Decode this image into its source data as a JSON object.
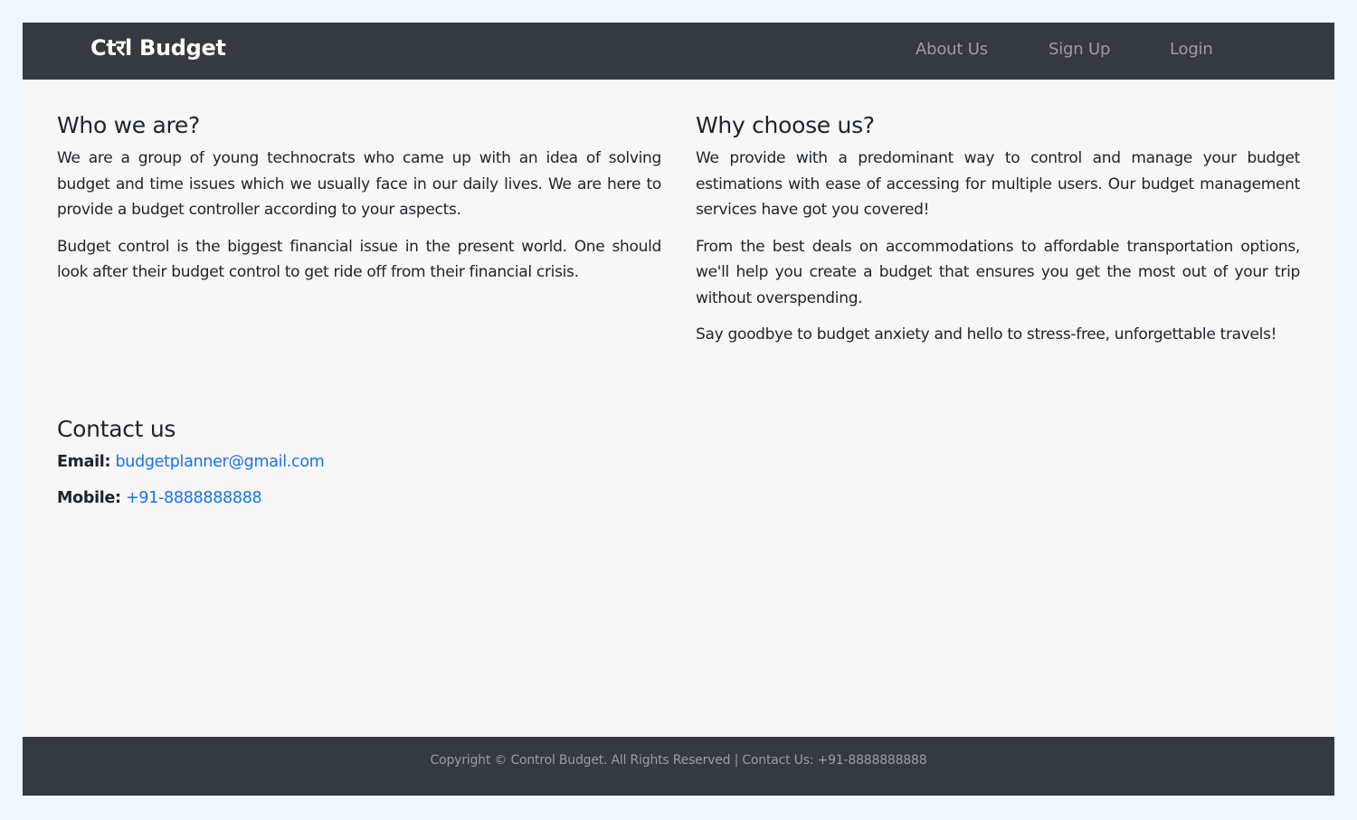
{
  "navbar": {
    "brand": "Ctरl Budget",
    "links": [
      "About Us",
      "Sign Up",
      "Login"
    ]
  },
  "who": {
    "heading": "Who we are?",
    "paragraphs": [
      "We are a group of young technocrats who came up with an idea of solving budget and time issues which we usually face in our daily lives. We are here to provide a budget controller according to your aspects.",
      "Budget control is the biggest financial issue in the present world. One should look after their budget control to get ride off from their financial crisis."
    ]
  },
  "why": {
    "heading": "Why choose us?",
    "paragraphs": [
      "We provide with a predominant way to control and manage your budget estimations with ease of accessing for multiple users. Our budget management services have got you covered!",
      "From the best deals on accommodations to affordable transportation options, we'll help you create a budget that ensures you get the most out of your trip without overspending.",
      "Say goodbye to budget anxiety and hello to stress-free, unforgettable travels!"
    ]
  },
  "contact": {
    "heading": "Contact us",
    "email_label": "Email:",
    "email_value": "budgetplanner@gmail.com",
    "mobile_label": "Mobile:",
    "mobile_value": "+91-8888888888"
  },
  "footer": {
    "text": "Copyright © Control Budget. All Rights Reserved | Contact Us: +91-8888888888"
  },
  "colors": {
    "navbar_bg": "#343a40",
    "page_bg": "#f7f7f7",
    "outer_bg": "#f0f7fe",
    "link": "#1a73e8",
    "nav_text": "#9a9da1"
  }
}
